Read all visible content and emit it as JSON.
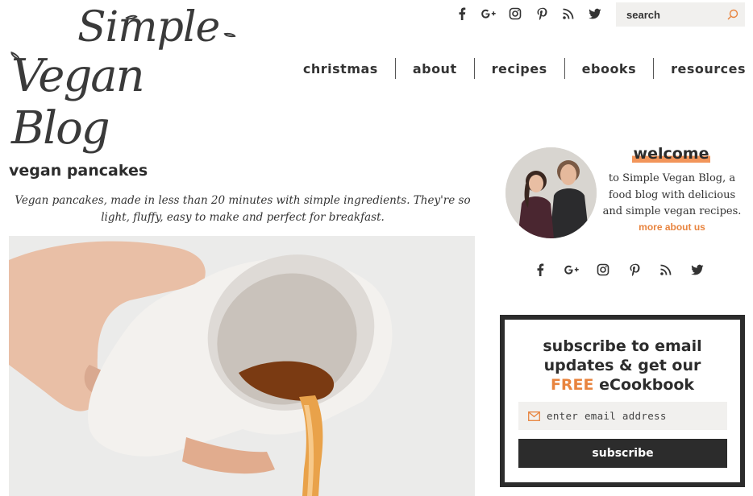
{
  "logo": {
    "line1": "Simple",
    "line2": "Vegan Blog"
  },
  "header": {
    "social": [
      "facebook-icon",
      "google-plus-icon",
      "instagram-icon",
      "pinterest-icon",
      "rss-icon",
      "twitter-icon"
    ],
    "search_placeholder": "search"
  },
  "nav": {
    "items": [
      {
        "label": "christmas"
      },
      {
        "label": "about"
      },
      {
        "label": "recipes"
      },
      {
        "label": "ebooks"
      },
      {
        "label": "resources"
      }
    ]
  },
  "post": {
    "title": "vegan pancakes",
    "intro": "Vegan pancakes, made in less than 20 minutes with simple ingredients. They're so light, fluffy, easy to make and perfect for breakfast."
  },
  "sidebar": {
    "welcome_title": "welcome",
    "welcome_text": "to Simple Vegan Blog, a food blog with delicious and simple vegan recipes.",
    "more_link": "more about us"
  },
  "subscribe": {
    "heading_line1": "subscribe to email",
    "heading_line2": "updates & get our",
    "heading_free": "FREE",
    "heading_rest": "eCookbook",
    "email_placeholder": "enter email address",
    "button_label": "subscribe"
  },
  "colors": {
    "accent": "#e8843f",
    "dark": "#2c2c2c",
    "field_bg": "#f1f0ee"
  }
}
